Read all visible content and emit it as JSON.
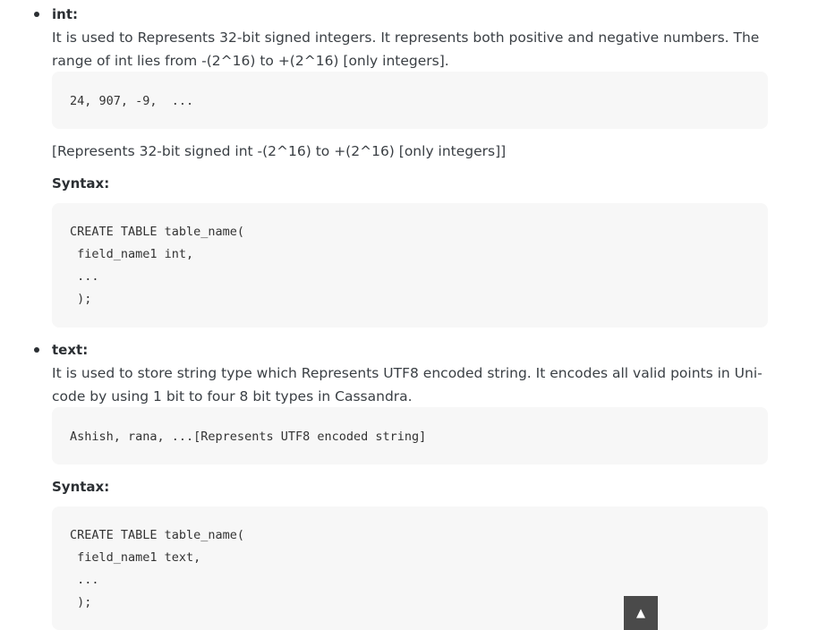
{
  "sections": [
    {
      "term": "int:",
      "desc_line1": "It is used to Represents 32-bit signed integers. It represents both positive and negative numbers. The",
      "desc_line2": "range of int lies from -(2^16) to +(2^16) [only integers].",
      "example": "24, 907, -9,  ...",
      "note": "[Represents 32-bit signed int -(2^16) to +(2^16) [only integers]]",
      "syntax_label": "Syntax:",
      "syntax_lines": [
        "CREATE TABLE table_name(",
        " field_name1 int,",
        " ...",
        " );"
      ]
    },
    {
      "term": "text:",
      "desc_line1": "It is used to store string type which Represents UTF8 encoded string. It encodes all valid points in Uni-",
      "desc_line2": "code by using 1 bit to four 8 bit types in Cassandra.",
      "example": "Ashish, rana, ...[Represents UTF8 encoded string]",
      "syntax_label": "Syntax:",
      "syntax_lines": [
        "CREATE TABLE table_name(",
        " field_name1 text,",
        " ...",
        " );"
      ]
    }
  ],
  "scroll_top": {
    "icon": "arrow-up-icon",
    "glyph": "▲"
  }
}
